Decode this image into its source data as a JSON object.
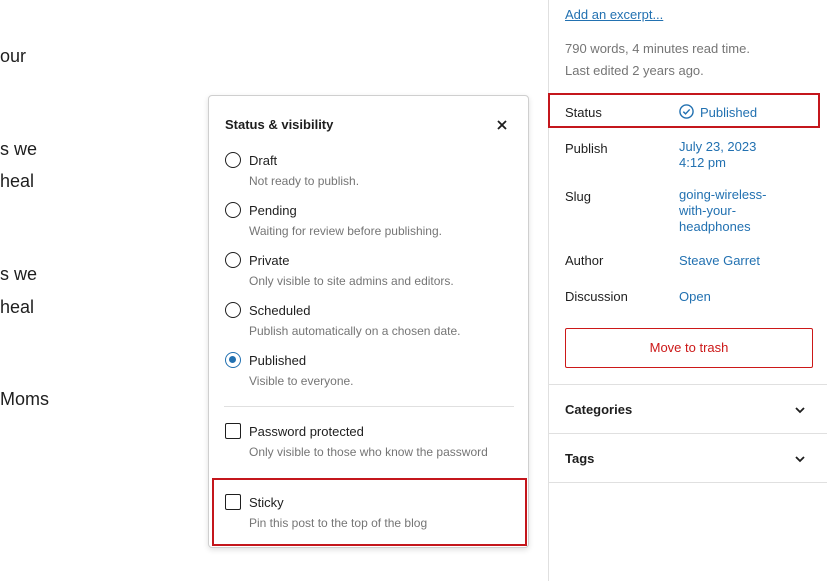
{
  "editor": {
    "fragments": [
      "our",
      "s we",
      "heal",
      "s we",
      "heal",
      "Moms"
    ]
  },
  "sidebar": {
    "excerpt_link": "Add an excerpt...",
    "word_count": "790 words, 4 minutes read time.",
    "last_edited": "Last edited 2 years ago.",
    "rows": {
      "status": {
        "label": "Status",
        "value": "Published"
      },
      "publish": {
        "label": "Publish",
        "date": "July 23, 2023",
        "time": "4:12 pm"
      },
      "slug": {
        "label": "Slug",
        "line1": "going-wireless-",
        "line2": "with-your-",
        "line3": "headphones"
      },
      "author": {
        "label": "Author",
        "value": "Steave Garret"
      },
      "discussion": {
        "label": "Discussion",
        "value": "Open"
      }
    },
    "trash_label": "Move to trash",
    "panels": {
      "categories": "Categories",
      "tags": "Tags"
    },
    "accent_color": "#2271b1",
    "danger_color": "#cc1818",
    "highlight_color": "#c4161c"
  },
  "popover": {
    "title": "Status & visibility",
    "close_icon": "close-icon",
    "options": [
      {
        "label": "Draft",
        "desc": "Not ready to publish.",
        "selected": false
      },
      {
        "label": "Pending",
        "desc": "Waiting for review before publishing.",
        "selected": false
      },
      {
        "label": "Private",
        "desc": "Only visible to site admins and editors.",
        "selected": false
      },
      {
        "label": "Scheduled",
        "desc": "Publish automatically on a chosen date.",
        "selected": false
      },
      {
        "label": "Published",
        "desc": "Visible to everyone.",
        "selected": true
      }
    ],
    "password": {
      "label": "Password protected",
      "desc": "Only visible to those who know the password",
      "checked": false
    },
    "sticky": {
      "label": "Sticky",
      "desc": "Pin this post to the top of the blog",
      "checked": false
    }
  }
}
